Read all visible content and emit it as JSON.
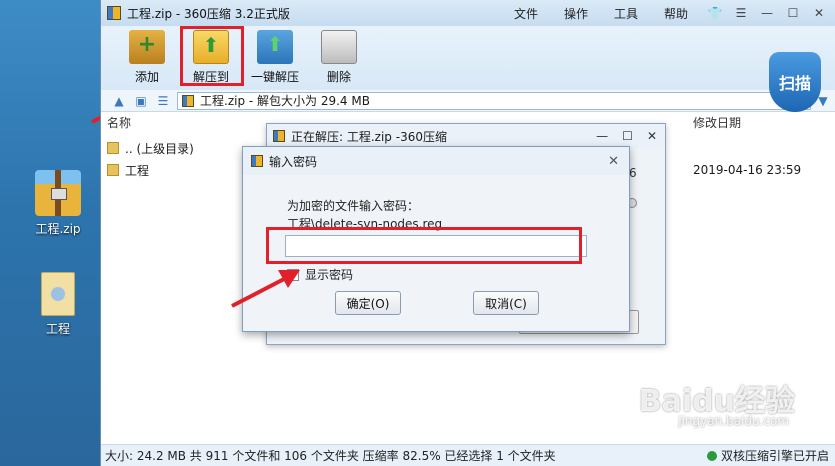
{
  "desktop": {
    "icons": [
      {
        "label": "工程.zip"
      },
      {
        "label": "工程"
      }
    ]
  },
  "window": {
    "title": "工程.zip - 360压缩 3.2正式版",
    "menu": [
      "文件",
      "操作",
      "工具",
      "帮助"
    ],
    "controls": {
      "shirt": "👕",
      "menu": "☰",
      "minimize": "—",
      "maximize": "☐",
      "close": "✕"
    }
  },
  "toolbar": {
    "add_label": "添加",
    "extract_label": "解压到",
    "one_key_label": "一键解压",
    "delete_label": "删除",
    "scan_label": "扫描"
  },
  "address": {
    "path": "工程.zip - 解包大小为 29.4 MB",
    "v": "V",
    "dropdown": "▼"
  },
  "columns": {
    "name": "名称",
    "modified": "修改日期"
  },
  "files": [
    {
      "name": ".. (上级目录)",
      "date": ""
    },
    {
      "name": "工程",
      "date": "2019-04-16 23:59"
    }
  ],
  "status": {
    "text": "大小: 24.2 MB 共 911 个文件和 106 个文件夹 压缩率 82.5% 已经选择 1 个文件夹",
    "engine": "双核压缩引擎已开启"
  },
  "extract_dialog": {
    "title": "正在解压: 工程.zip -360压缩",
    "fragment": "6"
  },
  "password_dialog": {
    "title": "输入密码",
    "prompt": "为加密的文件输入密码：",
    "filename": "工程\\delete-svn-nodes.reg",
    "password_value": "",
    "show_password_label": "显示密码",
    "ok_label": "确定(O)",
    "cancel_label": "取消(C)"
  },
  "watermark": {
    "text": "Baidu经验",
    "sub": "jingyan.baidu.com"
  },
  "colors": {
    "accent_red": "#e0202a",
    "accent_blue": "#2b74b9"
  }
}
